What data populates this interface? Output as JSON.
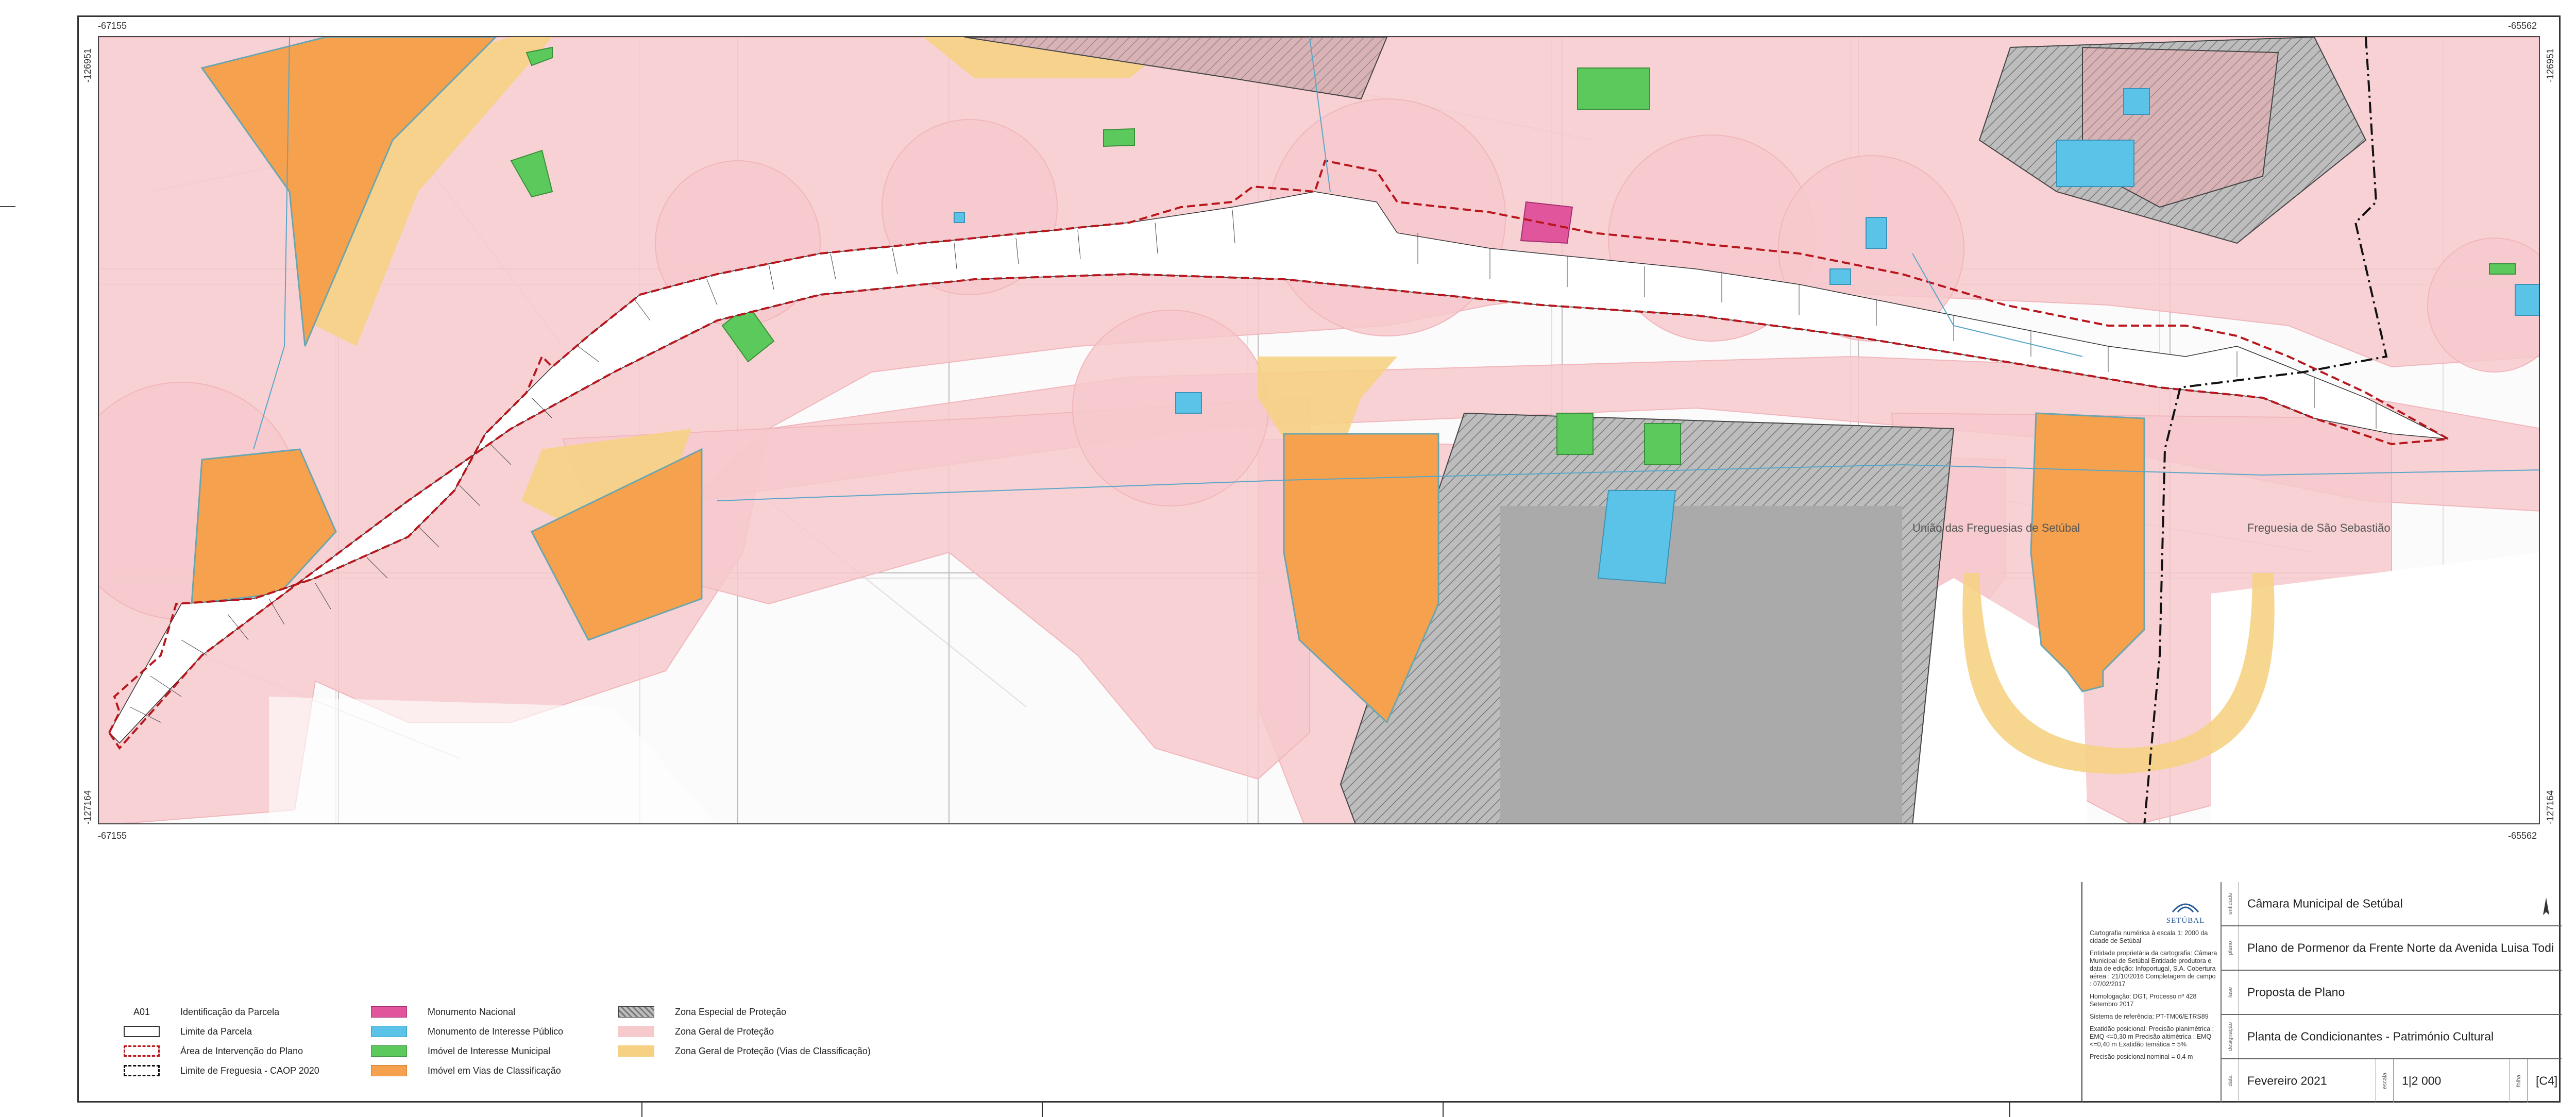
{
  "map": {
    "coords": {
      "top_left": "-67155",
      "top_right": "-65562",
      "bottom_left": "-67155",
      "bottom_right": "-65562",
      "left_top": "-126951",
      "left_bottom": "-127164",
      "right_top": "-126951",
      "right_bottom": "-127164"
    },
    "places": {
      "uniao": "União das Freguesias de Setúbal",
      "sao_sebastiao": "Freguesia de São Sebastião"
    },
    "colors": {
      "zona_geral": "#f6c9cd",
      "zona_especial": "#9a9a9a",
      "zona_vias": "#f6d184",
      "monumento_nacional": "#e0559b",
      "interesse_publico": "#5cc3e8",
      "interesse_municipal": "#5cc95c",
      "vias_classificacao": "#f5a14e",
      "intervencao": "#b8161c"
    }
  },
  "legend": {
    "code": "A01",
    "identificacao": "Identificação da Parcela",
    "limite_parcela": "Limite da Parcela",
    "area_intervencao": "Área de Intervenção do Plano",
    "limite_freguesia": "Limite de Freguesia - CAOP 2020",
    "monumento_nacional": "Monumento Nacional",
    "interesse_publico": "Monumento de Interesse Público",
    "interesse_municipal": "Imóvel de Interesse Municipal",
    "vias_classificacao": "Imóvel em Vias de Classificação",
    "zona_especial": "Zona Especial de Proteção",
    "zona_geral": "Zona Geral de Proteção",
    "zona_geral_vias": "Zona Geral de Proteção (Vias de Classificação)"
  },
  "titleblock": {
    "logo": "SETÚBAL",
    "notes": [
      "Cartografia numérica à escala 1: 2000 da cidade de Setúbal",
      "Entidade proprietária da cartografia: Câmara Municipal de Setúbal Entidade produtora e data de edição: Infoportugal, S.A. Cobertura aérea : 21/10/2016 Completagem de campo : 07/02/2017",
      "Homologação: DGT, Processo nº 428 Setembro 2017",
      "Sistema de referência: PT-TM06/ETRS89",
      "Exatidão posicional: Precisão planimétrica : EMQ <=0,30 m Precisão altimétrica : EMQ <=0,40 m Exatidão temática = 5%",
      "Precisão posicional nominal = 0,4 m"
    ],
    "entidade_label": "entidade",
    "entidade": "Câmara Municipal de Setúbal",
    "plano_label": "plano",
    "plano": "Plano de Pormenor da Frente Norte da Avenida Luisa Todi",
    "fase_label": "fase",
    "fase": "Proposta de Plano",
    "designacao_label": "designação",
    "designacao": "Planta de Condicionantes - Património Cultural",
    "data_label": "data",
    "data": "Fevereiro 2021",
    "escala_label": "escala",
    "escala": "1|2 000",
    "folha_label": "folha",
    "folha": "[C4]"
  }
}
